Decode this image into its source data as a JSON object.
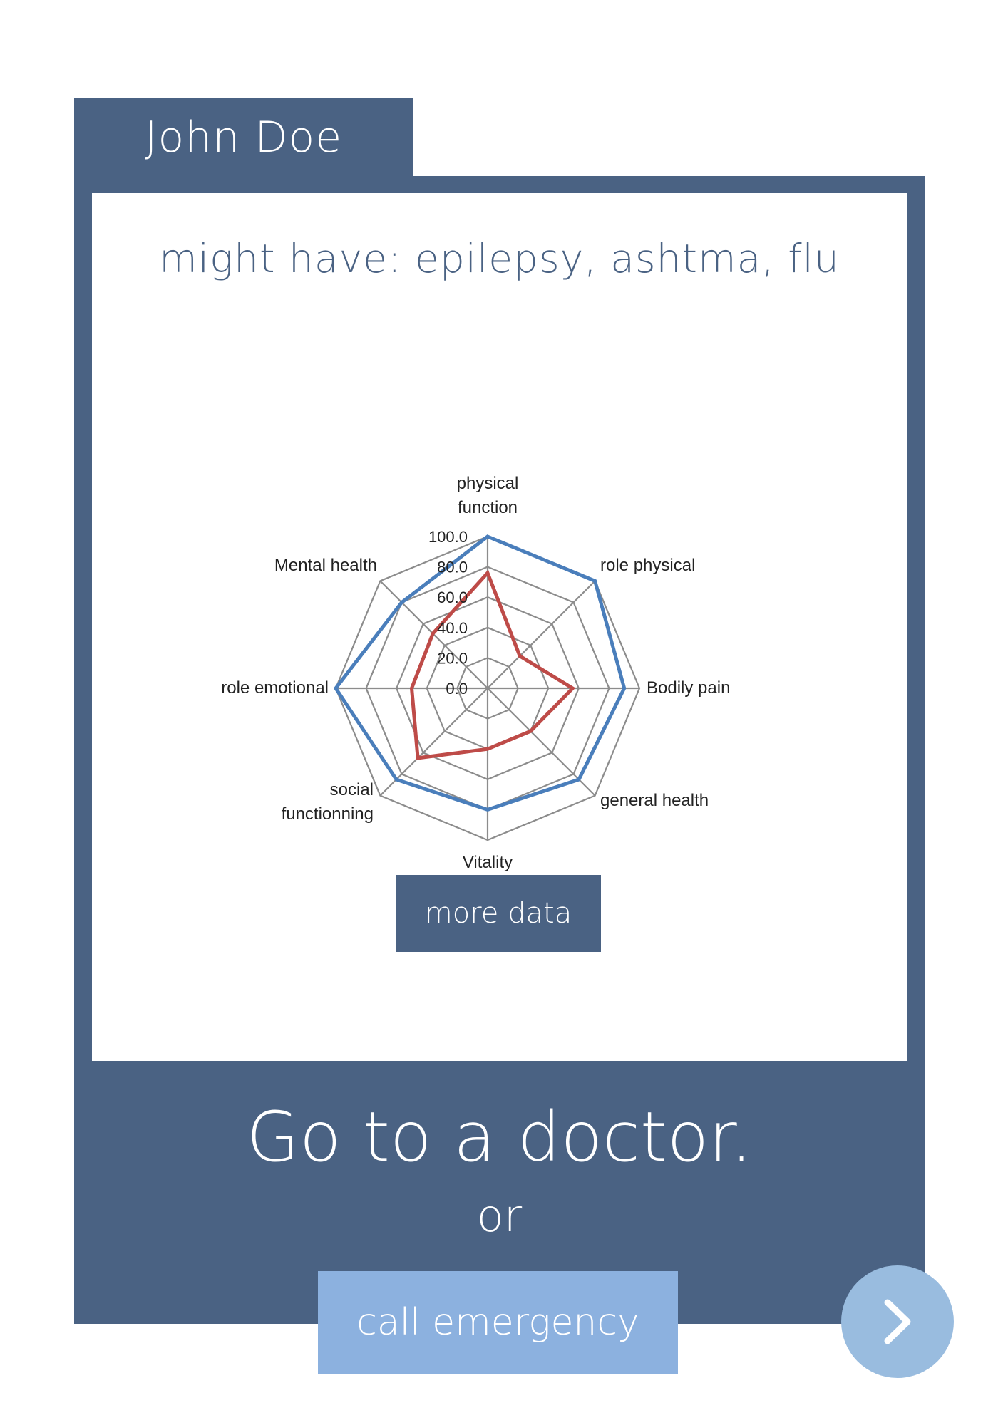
{
  "patient": {
    "name": "John Doe"
  },
  "diagnosis": {
    "text": "might have: epilepsy, ashtma, flu"
  },
  "chart_data": {
    "type": "radar",
    "axes": [
      "physical function",
      "role physical",
      "Bodily pain",
      "general health",
      "Vitality",
      "social functionning",
      "role emotional",
      "Mental health"
    ],
    "tick_labels": [
      "0.0",
      "20.0",
      "40.0",
      "60.0",
      "80.0",
      "100.0"
    ],
    "range": [
      0,
      100
    ],
    "grid": true,
    "series": [
      {
        "color": "#4a7ebb",
        "values": [
          100,
          100,
          90,
          85,
          80,
          85,
          100,
          80
        ]
      },
      {
        "color": "#be4b48",
        "values": [
          76,
          30,
          56,
          40,
          40,
          65,
          50,
          51
        ]
      }
    ]
  },
  "actions": {
    "more_data_label": "more data",
    "advice": "Go to a doctor.",
    "or_label": "or",
    "emergency_label": "call emergency"
  },
  "icons": {
    "next": "chevron-right-icon"
  },
  "colors": {
    "primary": "#4a6283",
    "accent": "#8cb1df",
    "next": "#99bcdf"
  }
}
